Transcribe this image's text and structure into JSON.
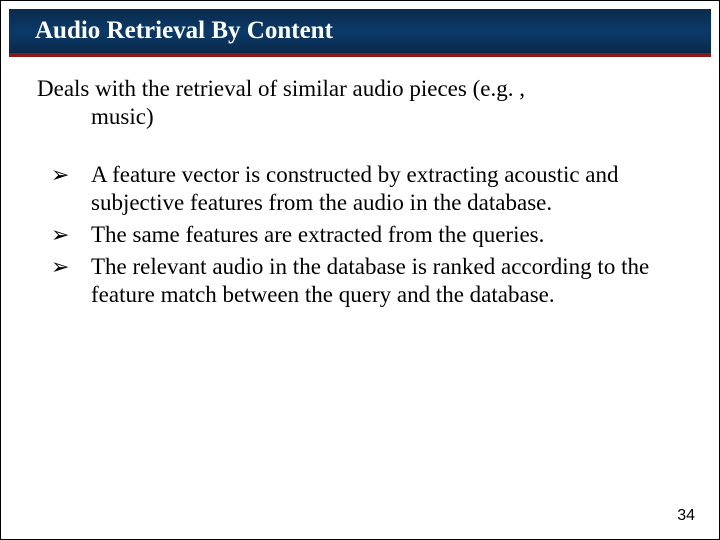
{
  "header": {
    "title": "Audio Retrieval By Content"
  },
  "intro": {
    "line1": "Deals with the retrieval of similar audio pieces (e.g. ,",
    "line2": "music)"
  },
  "bullets": [
    "A feature vector is constructed by extracting acoustic and subjective features from the audio in the database.",
    "The same features are extracted from the queries.",
    "The relevant audio in the database is ranked according to the feature match between the query and the database."
  ],
  "bullet_marker": "➢",
  "page_number": "34"
}
